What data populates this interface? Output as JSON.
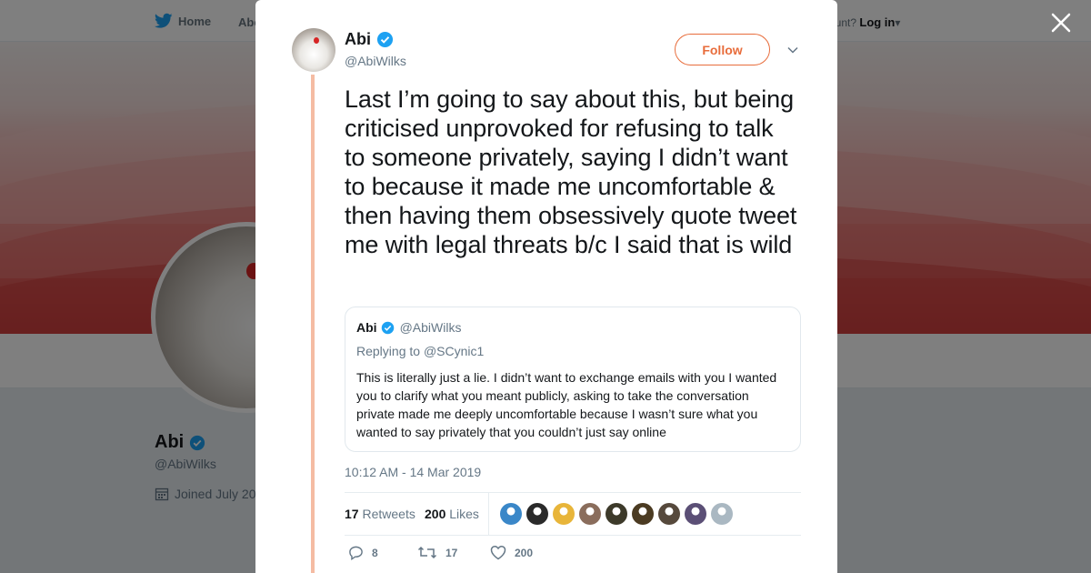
{
  "nav": {
    "home_label": "Home",
    "about_label": "Abo",
    "account_prompt": "ccount?",
    "login_label": "Log in"
  },
  "profile": {
    "name": "Abi",
    "handle": "@AbiWilks",
    "joined": "Joined July 20"
  },
  "tweet": {
    "author_name": "Abi",
    "author_handle": "@AbiWilks",
    "verified": true,
    "follow_label": "Follow",
    "text": "Last I’m going to say about this, but being criticised unprovoked for refusing to talk to someone privately, saying I didn’t want to because it made me uncomfortable & then having them obsessively quote tweet me with legal threats b/c I said that  is wild",
    "quoted": {
      "author_name": "Abi",
      "author_handle": "@AbiWilks",
      "replying_prefix": "Replying to",
      "replying_to": "@SCynic1",
      "text": "This is literally just a lie. I didn’t want to exchange emails with you I wanted you to clarify what you meant publicly, asking to take the conversation private made me deeply uncomfortable because I wasn’t sure what you wanted to say privately that you couldn’t just say online"
    },
    "timestamp": "10:12 AM - 14 Mar 2019",
    "retweets_count": "17",
    "retweets_label": "Retweets",
    "likes_count": "200",
    "likes_label": "Likes",
    "liker_avatar_colors": [
      "#3a87c8",
      "#2a2a2a",
      "#e8b53a",
      "#8a6d5c",
      "#3d3a2a",
      "#4b3b22",
      "#56493c",
      "#5b4f76",
      "#aab8c2"
    ],
    "actions": {
      "reply_count": "8",
      "retweet_count": "17",
      "like_count": "200"
    }
  },
  "colors": {
    "accent": "#e86d3c",
    "thread_line": "#f5bca3",
    "verified": "#1da1f2"
  }
}
